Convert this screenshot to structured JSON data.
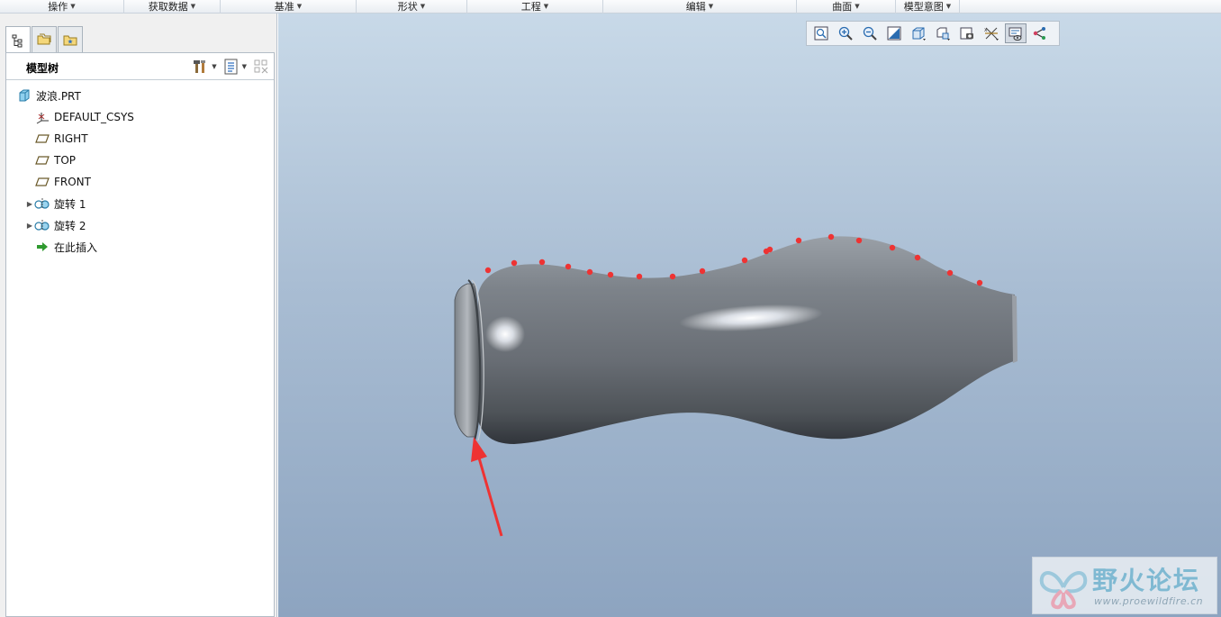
{
  "ribbon": {
    "groups": [
      {
        "label": "操作"
      },
      {
        "label": "获取数据"
      },
      {
        "label": "基准"
      },
      {
        "label": "形状"
      },
      {
        "label": "工程"
      },
      {
        "label": "编辑"
      },
      {
        "label": "曲面"
      },
      {
        "label": "模型意图"
      }
    ]
  },
  "model_tree": {
    "title": "模型树",
    "items": [
      {
        "label": "波浪.PRT",
        "icon": "part-icon"
      },
      {
        "label": "DEFAULT_CSYS",
        "icon": "csys-icon"
      },
      {
        "label": "RIGHT",
        "icon": "datum-plane-icon"
      },
      {
        "label": "TOP",
        "icon": "datum-plane-icon"
      },
      {
        "label": "FRONT",
        "icon": "datum-plane-icon"
      },
      {
        "label": "旋转 1",
        "icon": "revolve-icon"
      },
      {
        "label": "旋转 2",
        "icon": "revolve-icon"
      },
      {
        "label": "在此插入",
        "icon": "insert-here-icon"
      }
    ]
  },
  "view_toolbar": {
    "buttons": [
      "refit-icon",
      "zoom-in-icon",
      "zoom-out-icon",
      "repaint-icon",
      "display-style-icon",
      "saved-orientations-icon",
      "view-manager-icon",
      "datum-display-icon",
      "spin-center-icon",
      "annotation-display-icon"
    ]
  },
  "watermark": {
    "title": "野火论坛",
    "url": "www.proewildfire.cn"
  },
  "colors": {
    "accent_red": "#ee3333",
    "model_gray": "#6f747b",
    "viewport_top": "#c8d9e8",
    "viewport_bottom": "#8da4c0"
  }
}
